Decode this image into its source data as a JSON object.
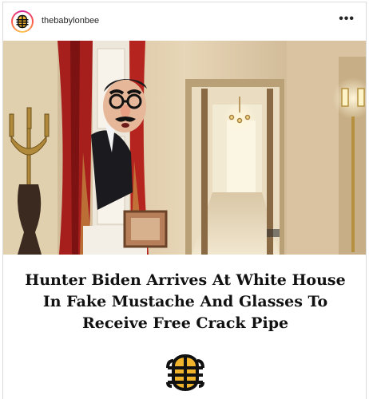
{
  "post": {
    "username": "thebabylonbee",
    "more_label": "•••",
    "photo_alt": "",
    "headline": "Hunter Biden Arrives At White House In Fake Mustache And Glasses To Receive Free Crack Pipe"
  },
  "colors": {
    "bee_yellow": "#f0b32c",
    "bee_black": "#111111",
    "border": "#dbdbdb"
  },
  "icons": {
    "avatar": "babylon-bee-logo-icon",
    "more": "more-options-icon",
    "logo": "babylon-bee-logo-icon"
  }
}
